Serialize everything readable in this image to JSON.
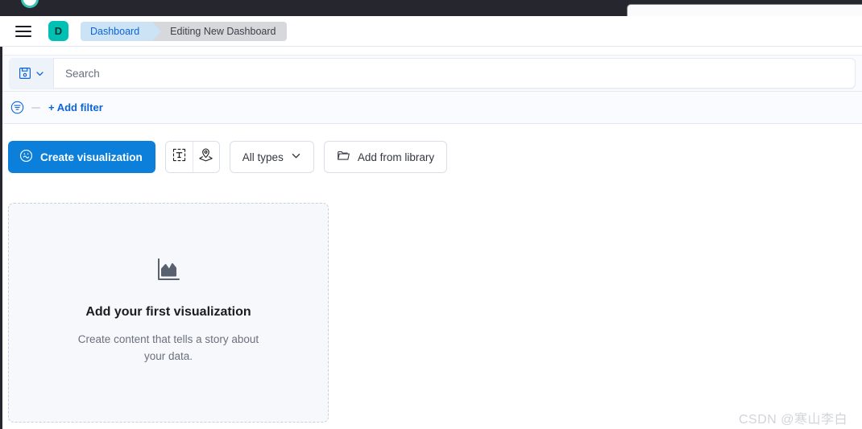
{
  "browser_chrome": {
    "logo_icon": "browser-logo-icon",
    "omnibox_name": "browser-address-bar"
  },
  "header": {
    "menu_icon": "hamburger-menu-icon",
    "space_avatar_label": "D",
    "breadcrumbs": [
      {
        "label": "Dashboard",
        "active": true
      },
      {
        "label": "Editing New Dashboard",
        "active": false
      }
    ]
  },
  "query_bar": {
    "saved_query_icon": "save-disk-icon",
    "saved_query_chevron_icon": "chevron-down-icon",
    "search_placeholder": "Search",
    "search_value": ""
  },
  "filter_bar": {
    "filter_toggle_icon": "filter-circle-icon",
    "add_filter_label": "+ Add filter"
  },
  "toolbar": {
    "create_visualization_label": "Create visualization",
    "create_visualization_icon": "lens-visualize-icon",
    "text_panel_icon": "text-markdown-icon",
    "map_panel_icon": "maps-layers-icon",
    "all_types_label": "All types",
    "all_types_chevron_icon": "chevron-down-icon",
    "add_from_library_label": "Add from library",
    "add_from_library_icon": "folder-open-icon"
  },
  "empty_state": {
    "icon": "area-chart-icon",
    "title": "Add your first visualization",
    "description": "Create content that tells a story about your data."
  },
  "watermark": {
    "text": "CSDN @寒山李白"
  },
  "colors": {
    "primary_blue": "#0B7FD9",
    "link_blue": "#0B64DD",
    "breadcrumb_active_bg": "#CCE3F5",
    "breadcrumb_inactive_bg": "#D6D8DC",
    "space_avatar_bg": "#00BFB3",
    "chrome_dark": "#25262E",
    "panel_bg": "#F7F8FC"
  }
}
